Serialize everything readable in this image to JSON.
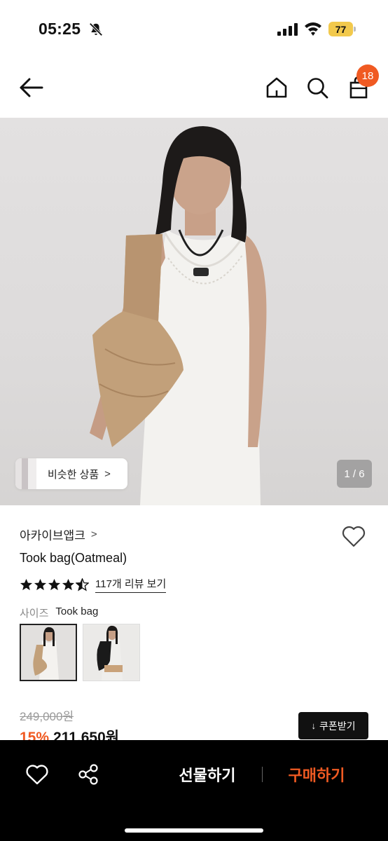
{
  "status_bar": {
    "time": "05:25",
    "battery": "77",
    "icons": [
      "bell-off-icon",
      "signal-icon",
      "wifi-icon",
      "battery-icon"
    ]
  },
  "nav": {
    "icons": [
      "back-arrow-icon",
      "home-icon",
      "search-icon",
      "shopping-bag-icon"
    ],
    "cart_count": "18"
  },
  "hero": {
    "similar_label": "비슷한 상품",
    "similar_chevron": ">",
    "page_counter": "1 / 6"
  },
  "product": {
    "brand": "아카이브앱크",
    "brand_chevron": ">",
    "title": "Took bag(Oatmeal)",
    "rating_stars": 4.5,
    "review_link": "117개 리뷰 보기",
    "option_label": "사이즈",
    "option_value": "Took bag",
    "swatches": [
      "oatmeal-swatch",
      "black-swatch"
    ]
  },
  "price": {
    "original": "249,000원",
    "discount": "15%",
    "current": "211,650원",
    "coupon_label": "쿠폰받기",
    "coupon_icon": "↓"
  },
  "bottom_bar": {
    "gift_label": "선물하기",
    "buy_label": "구매하기"
  },
  "colors": {
    "accent": "#f05a22",
    "bar": "#000000",
    "battery": "#f2c94c"
  }
}
